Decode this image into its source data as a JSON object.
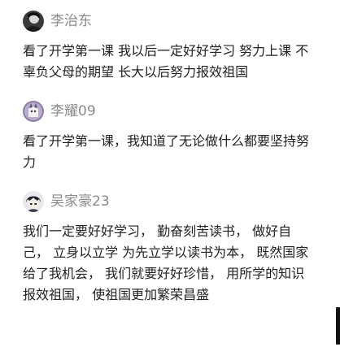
{
  "comments": [
    {
      "username": "李治东",
      "text": "看了开学第一课 我以后一定好好学习 努力上课 不辜负父母的期望 长大以后努力报效祖国",
      "avatar_icon": "dark-portrait-avatar"
    },
    {
      "username": "李耀09",
      "text": "看了开学第一课，我知道了无论做什么都要坚持努力",
      "avatar_icon": "purple-cartoon-avatar"
    },
    {
      "username": "吴家豪23",
      "text": "我们一定要好好学习， 勤奋刻苦读书， 做好自己， 立身以立学 为先立学以读书为本， 既然国家给了我机会， 我们就要好好珍惜， 用所学的知识报效祖国， 使祖国更加繁荣昌盛",
      "avatar_icon": "anime-character-avatar"
    }
  ],
  "colors": {
    "username": "#8a8a8a",
    "text": "#222222",
    "scrollbar": "#111111"
  }
}
